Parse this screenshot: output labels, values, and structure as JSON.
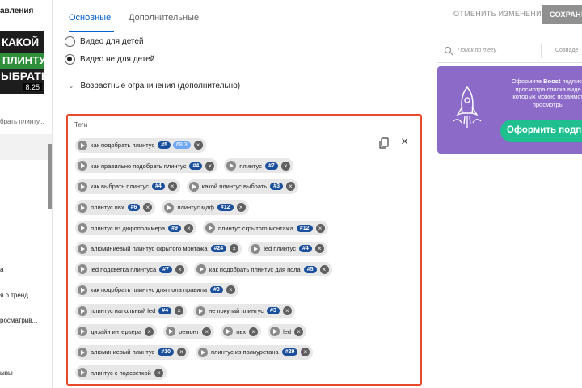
{
  "sidebar": {
    "title": "авления",
    "thumbnail": {
      "line1": "КАКОЙ",
      "line2": "ПЛИНТУС",
      "line3": "ЫБРАТЬ",
      "duration": "8:25"
    },
    "subtitle": "брать плинту...",
    "items": [
      "а",
      "я о тренд...",
      "росматрив...",
      "ывы"
    ]
  },
  "tabs": [
    {
      "label": "Основные",
      "active": true
    },
    {
      "label": "Дополнительные",
      "active": false
    }
  ],
  "header": {
    "undo_label": "ОТМЕНИТЬ ИЗМЕНЕНИЯ",
    "save_label": "СОХРАНИ"
  },
  "audience": {
    "options": [
      {
        "label": "Видео для детей",
        "checked": false
      },
      {
        "label": "Видео не для детей",
        "checked": true
      }
    ],
    "age_restrictions_label": "Возрастные ограничения (дополнительно)"
  },
  "tags_section": {
    "title": "Теги",
    "rows": [
      [
        {
          "text": "как подобрать плинтус",
          "rank": "#5",
          "score": "68.3"
        }
      ],
      [
        {
          "text": "как правильно подобрать плинтус",
          "rank": "#4"
        },
        {
          "text": "плинтус",
          "rank": "#7"
        }
      ],
      [
        {
          "text": "как выбрать плинтус",
          "rank": "#4"
        },
        {
          "text": "какой плинтус выбрать",
          "rank": "#3"
        }
      ],
      [
        {
          "text": "плинтус пвх",
          "rank": "#6"
        },
        {
          "text": "плинтус мдф",
          "rank": "#12"
        }
      ],
      [
        {
          "text": "плинтус из дюрополимера",
          "rank": "#9"
        },
        {
          "text": "плинтус скрытого монтажа",
          "rank": "#12"
        }
      ],
      [
        {
          "text": "алюминиевый плинтус скрытого монтажа",
          "rank": "#24"
        },
        {
          "text": "led плинтус",
          "rank": "#4"
        }
      ],
      [
        {
          "text": "led подсветка плинтуса",
          "rank": "#7"
        },
        {
          "text": "как подобрать плинтус для пола",
          "rank": "#5"
        }
      ],
      [
        {
          "text": "как подобрать плинтус для пола правила",
          "rank": "#3"
        }
      ],
      [
        {
          "text": "плинтус напольный led",
          "rank": "#4"
        },
        {
          "text": "не покупай плинтус",
          "rank": "#3"
        }
      ],
      [
        {
          "text": "дизайн интерьера"
        },
        {
          "text": "ремонт"
        },
        {
          "text": "пвх"
        },
        {
          "text": "led"
        }
      ],
      [
        {
          "text": "алюминиевый плинтус",
          "rank": "#10"
        },
        {
          "text": "плинтус из полиуретана",
          "rank": "#29"
        }
      ],
      [
        {
          "text": "плинтус с подсветкой"
        }
      ]
    ]
  },
  "right_panel": {
    "search_placeholder": "Поиск по тегу",
    "second_placeholder": "Совпаде",
    "promo": {
      "text_line1_pre": "Оформите ",
      "text_brand": "Boost",
      "text_line1_post": " подписк",
      "text_line2": "просмотра списка виде",
      "text_line3": "которых можно позаимст",
      "text_line4": "просмотры",
      "button_label": "Оформить подписк"
    }
  },
  "colors": {
    "accent": "#065fd4",
    "highlight_border": "#e8492a",
    "promo_bg": "#8c6bc8",
    "promo_button": "#1fbf8f",
    "rank_badge": "#1a4f9c"
  }
}
